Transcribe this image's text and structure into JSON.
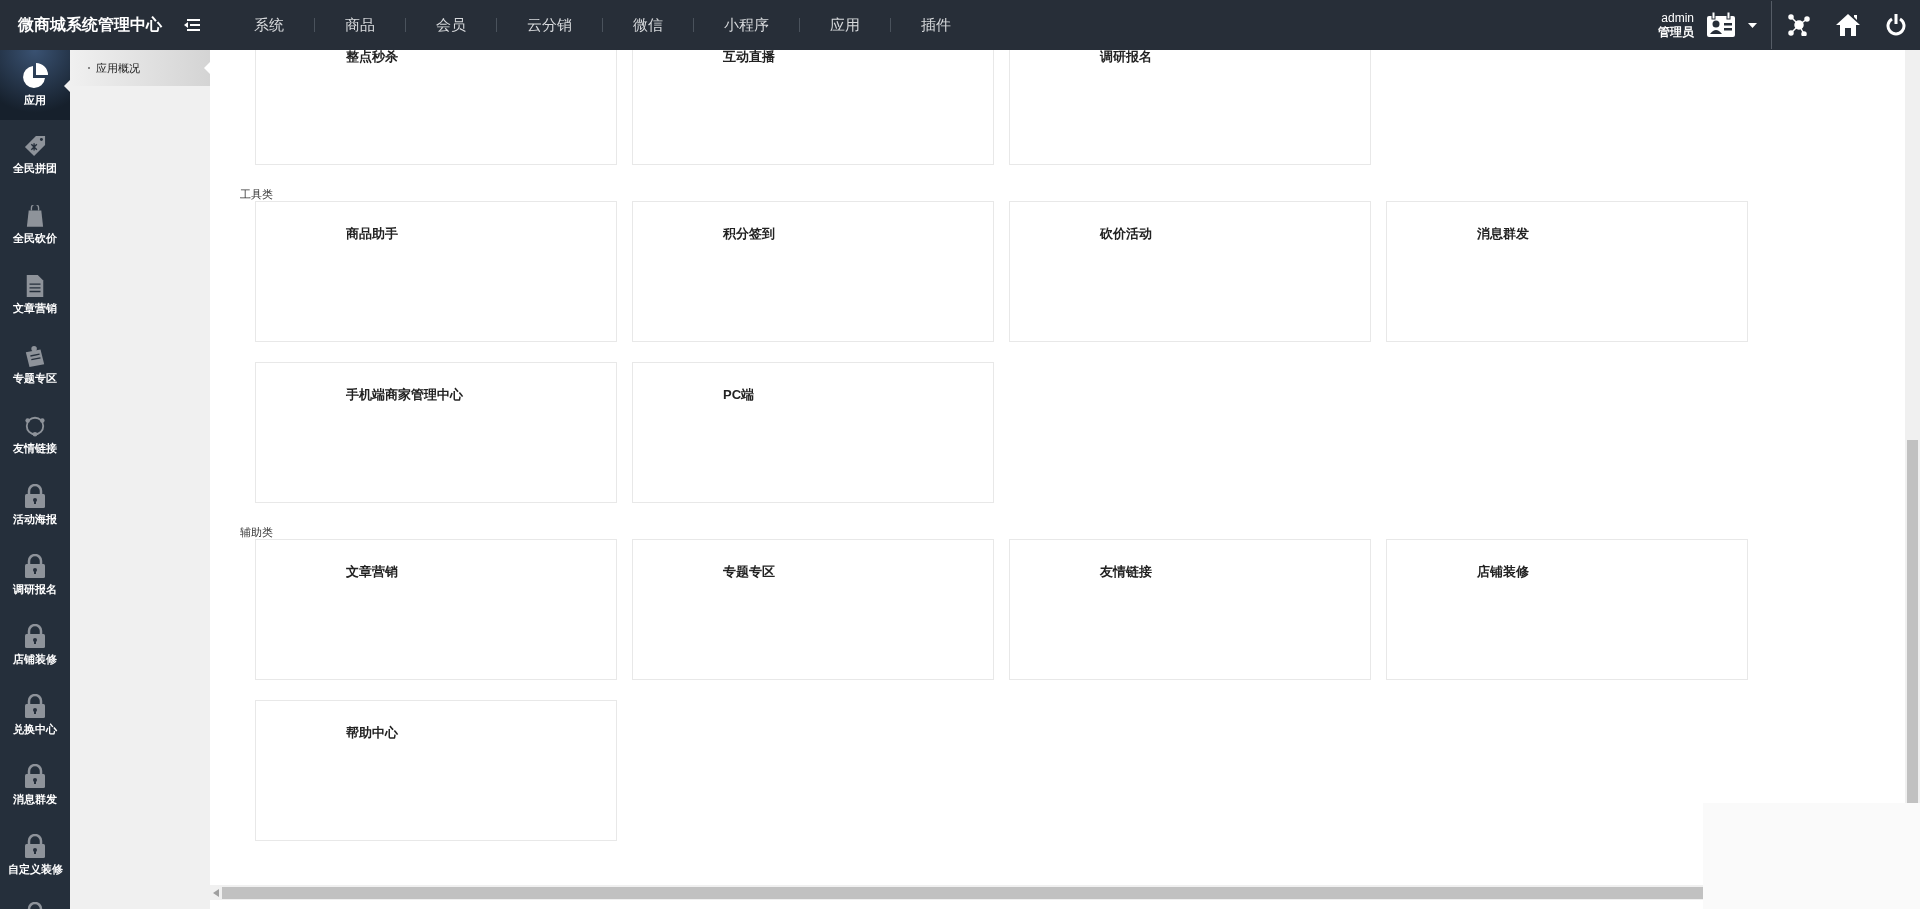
{
  "brand": "微商城系统管理中心",
  "top_nav": [
    {
      "label": "系统"
    },
    {
      "label": "商品"
    },
    {
      "label": "会员"
    },
    {
      "label": "云分销"
    },
    {
      "label": "微信"
    },
    {
      "label": "小程序"
    },
    {
      "label": "应用"
    },
    {
      "label": "插件"
    }
  ],
  "user": {
    "name": "admin",
    "role": "管理员"
  },
  "sidebar": [
    {
      "label": "应用",
      "kind": "pie",
      "selected": true
    },
    {
      "label": "全民拼团",
      "kind": "tag",
      "selected": false
    },
    {
      "label": "全民砍价",
      "kind": "bag",
      "selected": false
    },
    {
      "label": "文章营销",
      "kind": "doc",
      "selected": false
    },
    {
      "label": "专题专区",
      "kind": "clip",
      "selected": false
    },
    {
      "label": "友情链接",
      "kind": "cycle",
      "selected": false
    },
    {
      "label": "活动海报",
      "kind": "lock",
      "selected": false
    },
    {
      "label": "调研报名",
      "kind": "lock",
      "selected": false
    },
    {
      "label": "店铺装修",
      "kind": "lock",
      "selected": false
    },
    {
      "label": "兑换中心",
      "kind": "lock",
      "selected": false
    },
    {
      "label": "消息群发",
      "kind": "lock",
      "selected": false
    },
    {
      "label": "自定义装修",
      "kind": "lock",
      "selected": false
    },
    {
      "kind": "lock",
      "selected": false
    }
  ],
  "subnav": [
    {
      "label": "应用概况",
      "selected": true
    }
  ],
  "sections": [
    {
      "cards": [
        "整点秒杀",
        "互动直播",
        "调研报名"
      ]
    },
    {
      "title": "工具类",
      "cards": [
        "商品助手",
        "积分签到",
        "砍价活动",
        "消息群发",
        "手机端商家管理中心",
        "PC端"
      ]
    },
    {
      "title": "辅助类",
      "cards": [
        "文章营销",
        "专题专区",
        "友情链接",
        "店铺装修",
        "帮助中心"
      ]
    }
  ]
}
